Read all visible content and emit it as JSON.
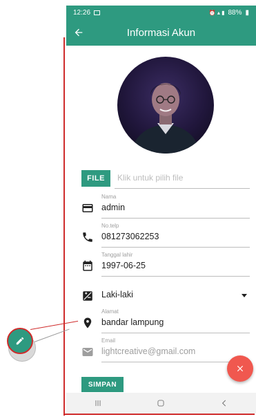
{
  "status_bar": {
    "time": "12:26",
    "battery": "88%"
  },
  "app_bar": {
    "title": "Informasi Akun"
  },
  "file_picker": {
    "button_label": "FILE",
    "placeholder": "Klik untuk pilih file"
  },
  "fields": {
    "name": {
      "label": "Nama",
      "value": "admin"
    },
    "phone": {
      "label": "No.telp",
      "value": "081273062253"
    },
    "birth_date": {
      "label": "Tanggal lahir",
      "value": "1997-06-25"
    },
    "gender": {
      "value": "Laki-laki"
    },
    "address": {
      "label": "Alamat",
      "value": "bandar lampung"
    },
    "email": {
      "label": "Email",
      "value": "lightcreative@gmail.com"
    }
  },
  "actions": {
    "save_label": "SIMPAN"
  },
  "colors": {
    "primary": "#2e9a80",
    "accent": "#f0584f",
    "annotation": "#cf2b2b"
  },
  "icons": {
    "back": "arrow-left-icon",
    "name": "card-icon",
    "phone": "phone-icon",
    "birth_date": "calendar-icon",
    "gender": "gender-icon",
    "address": "location-icon",
    "email": "mail-icon",
    "close": "close-icon",
    "edit": "pencil-icon",
    "nav_recent": "recents-icon",
    "nav_home": "home-icon",
    "nav_back": "chevron-left-icon"
  }
}
